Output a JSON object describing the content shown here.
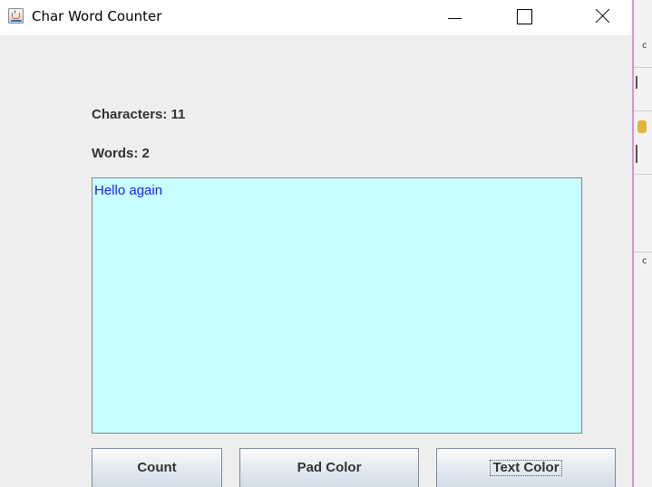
{
  "window": {
    "title": "Char Word Counter",
    "icon": "java-cup-icon"
  },
  "stats": {
    "characters_label": "Characters: 11",
    "words_label": "Words: 2",
    "characters": 11,
    "words": 2
  },
  "text_pad": {
    "value": "Hello again",
    "background_color": "#c8ffff",
    "text_color": "#1a1aff"
  },
  "buttons": {
    "count": "Count",
    "pad_color": "Pad Color",
    "text_color": "Text Color"
  },
  "background_window": {
    "marks": [
      "c",
      "c"
    ]
  }
}
